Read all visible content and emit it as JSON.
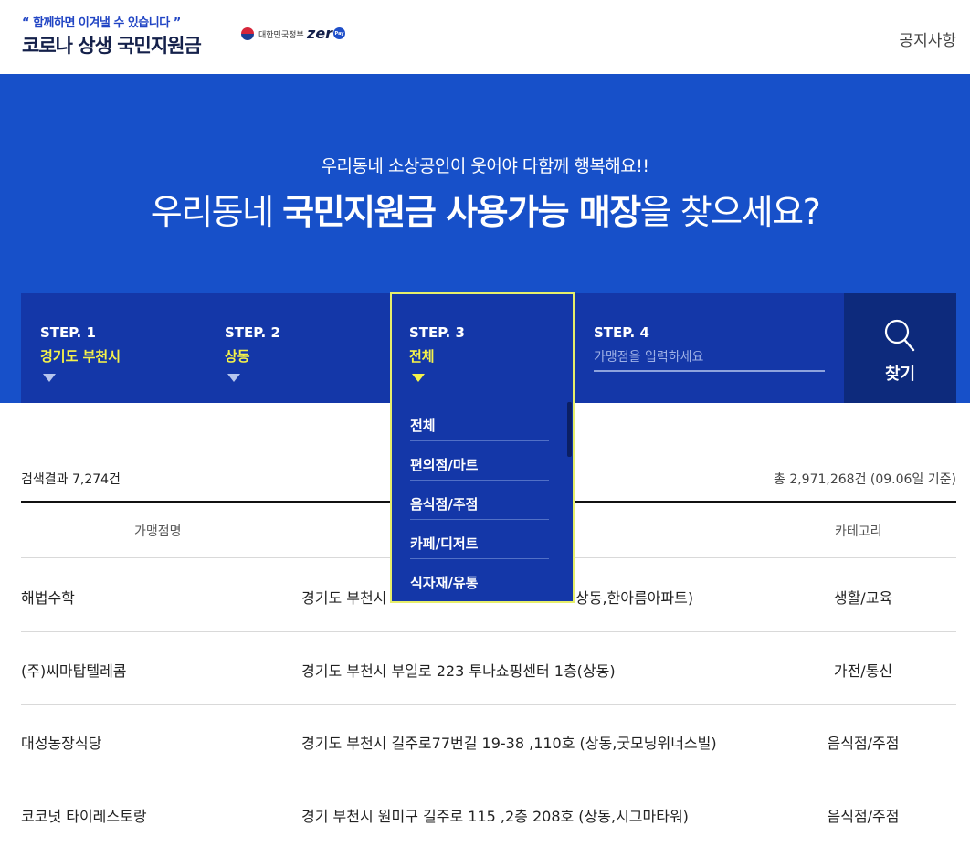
{
  "header": {
    "tagline": "“ 함께하면 이겨낼 수 있습니다 ”",
    "title": "코로나 상생 국민지원금",
    "gov_label": "대한민국정부",
    "zero_label": "zer",
    "zero_pay": "Pay",
    "notice": "공지사항"
  },
  "hero": {
    "subtitle": "우리동네 소상공인이 웃어야 다함께 행복해요!!",
    "title_pre": "우리동네 ",
    "title_bold": "국민지원금 사용가능 매장",
    "title_post": "을 찾으세요?"
  },
  "steps": [
    {
      "label": "STEP. 1",
      "value": "경기도 부천시"
    },
    {
      "label": "STEP. 2",
      "value": "상동"
    },
    {
      "label": "STEP. 3",
      "value": "전체"
    },
    {
      "label": "STEP. 4",
      "placeholder": "가맹점을 입력하세요"
    }
  ],
  "search_button": "찾기",
  "dropdown": [
    "전체",
    "편의점/마트",
    "음식점/주점",
    "카페/디저트",
    "식자재/유통"
  ],
  "results": {
    "count": "검색결과 7,274건",
    "total": "총 2,971,268건 (09.06일 기준)",
    "headers": [
      "가맹점명",
      "카테고리"
    ],
    "rows": [
      {
        "name": "해법수학",
        "address": "경기도 부천시 ",
        "address_tail": "상동,한아름아파트)",
        "category": "생활/교육"
      },
      {
        "name": "(주)씨마탑텔레콤",
        "address": "경기도 부천시 부일로 223 투나쇼핑센터 1층(상동)",
        "category": "가전/통신"
      },
      {
        "name": "대성농장식당",
        "address": "경기도 부천시 길주로77번길 19-38 ,110호 (상동,굿모닝위너스빌)",
        "category": "음식점/주점"
      },
      {
        "name": "코코넛 타이레스토랑",
        "address": "경기 부천시 원미구 길주로 115 ,2층 208호 (상동,시그마타워)",
        "category": "음식점/주점"
      }
    ]
  }
}
